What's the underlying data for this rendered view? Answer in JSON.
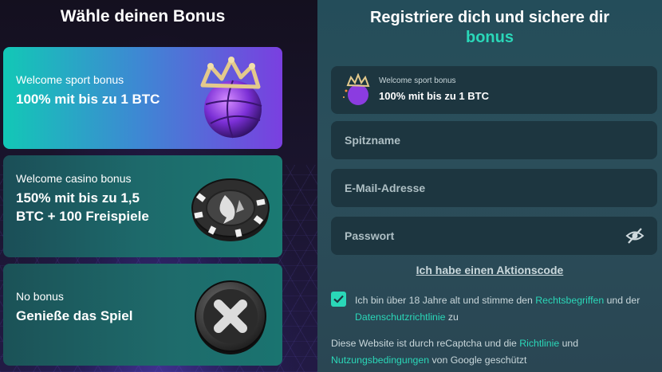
{
  "left": {
    "title": "Wähle deinen Bonus",
    "cards": [
      {
        "small": "Welcome sport bonus",
        "big": "100% mit bis zu 1 BTC",
        "icon": "basketball-crown-icon"
      },
      {
        "small": "Welcome casino bonus",
        "big": "150% mit bis zu 1,5 BTC + 100 Freispiele",
        "icon": "casino-chip-icon"
      },
      {
        "small": "No bonus",
        "big": "Genieße das Spiel",
        "icon": "no-bonus-x-icon"
      }
    ]
  },
  "right": {
    "title": "Registriere dich und sichere dir",
    "title_accent": "bonus",
    "selected": {
      "small": "Welcome sport bonus",
      "big": "100% mit bis zu 1 BTC"
    },
    "fields": {
      "nickname_placeholder": "Spitzname",
      "email_placeholder": "E-Mail-Adresse",
      "password_placeholder": "Passwort"
    },
    "promo_link": "Ich habe einen Aktionscode",
    "terms": {
      "text1": "Ich bin über 18 Jahre alt und stimme den ",
      "link1": "Rechtsbegriffen",
      "text2": " und der ",
      "link2": "Datenschutzrichtlinie",
      "text3": " zu",
      "checked": true
    },
    "captcha": {
      "text1": "Diese Website ist durch reCaptcha und die ",
      "link1": "Richtlinie",
      "text2": " und ",
      "link2": "Nutzungsbedingungen",
      "text3": " von Google geschützt"
    }
  },
  "colors": {
    "accent": "#2ad7b8"
  }
}
